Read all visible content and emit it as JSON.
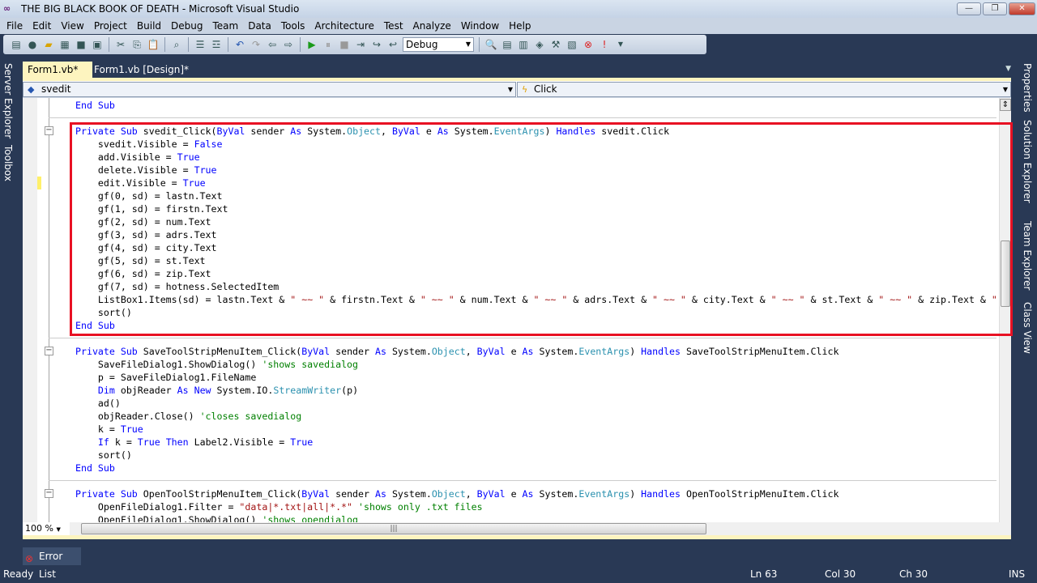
{
  "window": {
    "title": "THE BIG BLACK BOOK OF DEATH - Microsoft Visual Studio",
    "minimize": "—",
    "restore": "❐",
    "close": "✕"
  },
  "menu": [
    "File",
    "Edit",
    "View",
    "Project",
    "Build",
    "Debug",
    "Team",
    "Data",
    "Tools",
    "Architecture",
    "Test",
    "Analyze",
    "Window",
    "Help"
  ],
  "toolbar": {
    "configuration": "Debug"
  },
  "left_dock": [
    "Server Explorer",
    "Toolbox"
  ],
  "right_dock": [
    "Properties",
    "Solution Explorer",
    "Team Explorer",
    "Class View"
  ],
  "tabs": [
    {
      "label": "Form1.vb*",
      "active": true,
      "close": "×"
    },
    {
      "label": "Form1.vb [Design]*",
      "active": false
    }
  ],
  "navigation": {
    "object": "svedit",
    "event": "Click"
  },
  "code": [
    [
      [
        "k",
        "End Sub"
      ]
    ],
    [],
    [
      [
        "k",
        "Private Sub "
      ],
      [
        "n",
        "svedit_Click("
      ],
      [
        "k",
        "ByVal "
      ],
      [
        "n",
        "sender "
      ],
      [
        "k",
        "As "
      ],
      [
        "n",
        "System."
      ],
      [
        "t",
        "Object"
      ],
      [
        "n",
        ", "
      ],
      [
        "k",
        "ByVal "
      ],
      [
        "n",
        "e "
      ],
      [
        "k",
        "As "
      ],
      [
        "n",
        "System."
      ],
      [
        "t",
        "EventArgs"
      ],
      [
        "n",
        ") "
      ],
      [
        "k",
        "Handles "
      ],
      [
        "n",
        "svedit.Click"
      ]
    ],
    [
      [
        "n",
        "    svedit.Visible = "
      ],
      [
        "k",
        "False"
      ]
    ],
    [
      [
        "n",
        "    add.Visible = "
      ],
      [
        "k",
        "True"
      ]
    ],
    [
      [
        "n",
        "    delete.Visible = "
      ],
      [
        "k",
        "True"
      ]
    ],
    [
      [
        "n",
        "    edit.Visible = "
      ],
      [
        "k",
        "True"
      ]
    ],
    [
      [
        "n",
        "    gf(0, sd) = lastn.Text"
      ]
    ],
    [
      [
        "n",
        "    gf(1, sd) = firstn.Text"
      ]
    ],
    [
      [
        "n",
        "    gf(2, sd) = num.Text"
      ]
    ],
    [
      [
        "n",
        "    gf(3, sd) = adrs.Text"
      ]
    ],
    [
      [
        "n",
        "    gf(4, sd) = city.Text"
      ]
    ],
    [
      [
        "n",
        "    gf(5, sd) = st.Text"
      ]
    ],
    [
      [
        "n",
        "    gf(6, sd) = zip.Text"
      ]
    ],
    [
      [
        "n",
        "    gf(7, sd) = hotness.SelectedItem"
      ]
    ],
    [
      [
        "n",
        "    ListBox1.Items(sd) = lastn.Text & "
      ],
      [
        "s",
        "\" ~~ \""
      ],
      [
        "n",
        " & firstn.Text & "
      ],
      [
        "s",
        "\" ~~ \""
      ],
      [
        "n",
        " & num.Text & "
      ],
      [
        "s",
        "\" ~~ \""
      ],
      [
        "n",
        " & adrs.Text & "
      ],
      [
        "s",
        "\" ~~ \""
      ],
      [
        "n",
        " & city.Text & "
      ],
      [
        "s",
        "\" ~~ \""
      ],
      [
        "n",
        " & st.Text & "
      ],
      [
        "s",
        "\" ~~ \""
      ],
      [
        "n",
        " & zip.Text & "
      ],
      [
        "s",
        "\""
      ]
    ],
    [
      [
        "n",
        "    sort()"
      ]
    ],
    [
      [
        "k",
        "End Sub"
      ]
    ],
    [],
    [
      [
        "k",
        "Private Sub "
      ],
      [
        "n",
        "SaveToolStripMenuItem_Click("
      ],
      [
        "k",
        "ByVal "
      ],
      [
        "n",
        "sender "
      ],
      [
        "k",
        "As "
      ],
      [
        "n",
        "System."
      ],
      [
        "t",
        "Object"
      ],
      [
        "n",
        ", "
      ],
      [
        "k",
        "ByVal "
      ],
      [
        "n",
        "e "
      ],
      [
        "k",
        "As "
      ],
      [
        "n",
        "System."
      ],
      [
        "t",
        "EventArgs"
      ],
      [
        "n",
        ") "
      ],
      [
        "k",
        "Handles "
      ],
      [
        "n",
        "SaveToolStripMenuItem.Click"
      ]
    ],
    [
      [
        "n",
        "    SaveFileDialog1.ShowDialog() "
      ],
      [
        "c",
        "'shows savedialog"
      ]
    ],
    [
      [
        "n",
        "    p = SaveFileDialog1.FileName"
      ]
    ],
    [
      [
        "n",
        "    "
      ],
      [
        "k",
        "Dim "
      ],
      [
        "n",
        "objReader "
      ],
      [
        "k",
        "As New "
      ],
      [
        "n",
        "System.IO."
      ],
      [
        "t",
        "StreamWriter"
      ],
      [
        "n",
        "(p)"
      ]
    ],
    [
      [
        "n",
        "    ad()"
      ]
    ],
    [
      [
        "n",
        "    objReader.Close() "
      ],
      [
        "c",
        "'closes savedialog"
      ]
    ],
    [
      [
        "n",
        "    k = "
      ],
      [
        "k",
        "True"
      ]
    ],
    [
      [
        "n",
        "    "
      ],
      [
        "k",
        "If "
      ],
      [
        "n",
        "k = "
      ],
      [
        "k",
        "True Then "
      ],
      [
        "n",
        "Label2.Visible = "
      ],
      [
        "k",
        "True"
      ]
    ],
    [
      [
        "n",
        "    sort()"
      ]
    ],
    [
      [
        "k",
        "End Sub"
      ]
    ],
    [],
    [
      [
        "k",
        "Private Sub "
      ],
      [
        "n",
        "OpenToolStripMenuItem_Click("
      ],
      [
        "k",
        "ByVal "
      ],
      [
        "n",
        "sender "
      ],
      [
        "k",
        "As "
      ],
      [
        "n",
        "System."
      ],
      [
        "t",
        "Object"
      ],
      [
        "n",
        ", "
      ],
      [
        "k",
        "ByVal "
      ],
      [
        "n",
        "e "
      ],
      [
        "k",
        "As "
      ],
      [
        "n",
        "System."
      ],
      [
        "t",
        "EventArgs"
      ],
      [
        "n",
        ") "
      ],
      [
        "k",
        "Handles "
      ],
      [
        "n",
        "OpenToolStripMenuItem.Click"
      ]
    ],
    [
      [
        "n",
        "    OpenFileDialog1.Filter = "
      ],
      [
        "s",
        "\"data|*.txt|all|*.*\""
      ],
      [
        "n",
        " "
      ],
      [
        "c",
        "'shows only .txt files"
      ]
    ],
    [
      [
        "n",
        "    OpenFileDialog1.ShowDialog() "
      ],
      [
        "c",
        "'shows opendialog"
      ]
    ]
  ],
  "editor": {
    "zoom": "100 %",
    "grip": "|||"
  },
  "error_list": {
    "label": "Error List"
  },
  "status": {
    "state": "Ready",
    "line": "Ln 63",
    "col": "Col 30",
    "ch": "Ch 30",
    "mode": "INS"
  },
  "colors": {
    "keyword": "#0000ff",
    "type": "#2b91af",
    "string": "#a31515",
    "comment": "#008000",
    "highlight_box": "#e81123",
    "background": "#293955"
  }
}
